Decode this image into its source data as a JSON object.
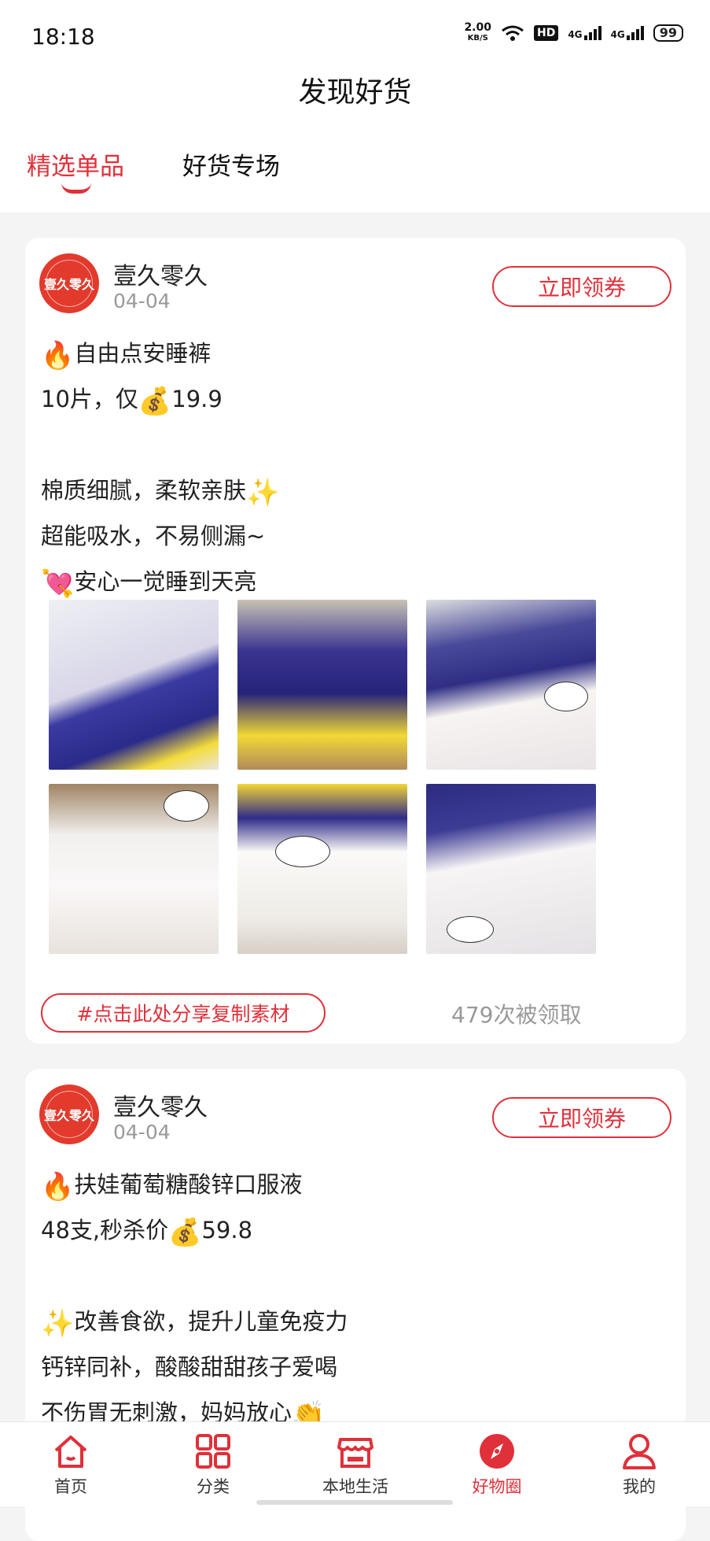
{
  "status_bar": {
    "time": "18:18",
    "net_speed_value": "2.00",
    "net_speed_unit": "KB/S",
    "hd_label": "HD",
    "sim1": "4G",
    "sim2": "4G",
    "battery": "99"
  },
  "header": {
    "title": "发现好货"
  },
  "tabs": [
    {
      "label": "精选单品",
      "active": true
    },
    {
      "label": "好货专场",
      "active": false
    }
  ],
  "posts": [
    {
      "shop_name": "壹久零久",
      "avatar_text": "壹久零久",
      "date": "04-04",
      "coupon_label": "立即领券",
      "lines": [
        {
          "emoji": "🔥",
          "text": "自由点安睡裤"
        },
        {
          "text": "10片，仅",
          "emoji_after": "💰",
          "text_after": "19.9"
        },
        {
          "text": ""
        },
        {
          "text": "棉质细腻，柔软亲肤",
          "emoji_after": "✨"
        },
        {
          "text": "超能吸水，不易侧漏~"
        },
        {
          "emoji": "💘",
          "text": "安心一觉睡到天亮"
        }
      ],
      "share_label": "#点击此处分享复制素材",
      "claimed_text": "479次被领取"
    },
    {
      "shop_name": "壹久零久",
      "avatar_text": "壹久零久",
      "date": "04-04",
      "coupon_label": "立即领券",
      "lines": [
        {
          "emoji": "🔥",
          "text": "扶娃葡萄糖酸锌口服液"
        },
        {
          "text": "48支,秒杀价",
          "emoji_after": "💰",
          "text_after": "59.8"
        },
        {
          "text": ""
        },
        {
          "emoji": "✨",
          "text": "改善食欲，提升儿童免疫力"
        },
        {
          "text": "钙锌同补，酸酸甜甜孩子爱喝"
        },
        {
          "text": "不伤胃无刺激，妈妈放心",
          "emoji_after": "👏"
        }
      ]
    }
  ],
  "bottom_nav": [
    {
      "label": "首页",
      "icon": "home-icon",
      "active": false
    },
    {
      "label": "分类",
      "icon": "grid-icon",
      "active": false
    },
    {
      "label": "本地生活",
      "icon": "store-icon",
      "active": false
    },
    {
      "label": "好物圈",
      "icon": "compass-icon",
      "active": true
    },
    {
      "label": "我的",
      "icon": "user-icon",
      "active": false
    }
  ],
  "colors": {
    "accent": "#e0303a",
    "background": "#f4f4f4",
    "muted": "#999999"
  }
}
